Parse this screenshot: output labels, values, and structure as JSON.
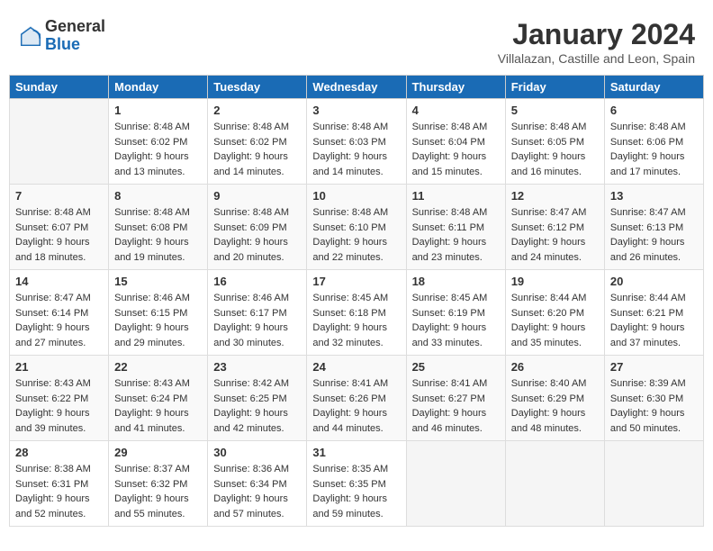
{
  "logo": {
    "general": "General",
    "blue": "Blue"
  },
  "header": {
    "month": "January 2024",
    "location": "Villalazan, Castille and Leon, Spain"
  },
  "weekdays": [
    "Sunday",
    "Monday",
    "Tuesday",
    "Wednesday",
    "Thursday",
    "Friday",
    "Saturday"
  ],
  "weeks": [
    [
      {
        "day": "",
        "sunrise": "",
        "sunset": "",
        "daylight": ""
      },
      {
        "day": "1",
        "sunrise": "Sunrise: 8:48 AM",
        "sunset": "Sunset: 6:02 PM",
        "daylight": "Daylight: 9 hours and 13 minutes."
      },
      {
        "day": "2",
        "sunrise": "Sunrise: 8:48 AM",
        "sunset": "Sunset: 6:02 PM",
        "daylight": "Daylight: 9 hours and 14 minutes."
      },
      {
        "day": "3",
        "sunrise": "Sunrise: 8:48 AM",
        "sunset": "Sunset: 6:03 PM",
        "daylight": "Daylight: 9 hours and 14 minutes."
      },
      {
        "day": "4",
        "sunrise": "Sunrise: 8:48 AM",
        "sunset": "Sunset: 6:04 PM",
        "daylight": "Daylight: 9 hours and 15 minutes."
      },
      {
        "day": "5",
        "sunrise": "Sunrise: 8:48 AM",
        "sunset": "Sunset: 6:05 PM",
        "daylight": "Daylight: 9 hours and 16 minutes."
      },
      {
        "day": "6",
        "sunrise": "Sunrise: 8:48 AM",
        "sunset": "Sunset: 6:06 PM",
        "daylight": "Daylight: 9 hours and 17 minutes."
      }
    ],
    [
      {
        "day": "7",
        "sunrise": "Sunrise: 8:48 AM",
        "sunset": "Sunset: 6:07 PM",
        "daylight": "Daylight: 9 hours and 18 minutes."
      },
      {
        "day": "8",
        "sunrise": "Sunrise: 8:48 AM",
        "sunset": "Sunset: 6:08 PM",
        "daylight": "Daylight: 9 hours and 19 minutes."
      },
      {
        "day": "9",
        "sunrise": "Sunrise: 8:48 AM",
        "sunset": "Sunset: 6:09 PM",
        "daylight": "Daylight: 9 hours and 20 minutes."
      },
      {
        "day": "10",
        "sunrise": "Sunrise: 8:48 AM",
        "sunset": "Sunset: 6:10 PM",
        "daylight": "Daylight: 9 hours and 22 minutes."
      },
      {
        "day": "11",
        "sunrise": "Sunrise: 8:48 AM",
        "sunset": "Sunset: 6:11 PM",
        "daylight": "Daylight: 9 hours and 23 minutes."
      },
      {
        "day": "12",
        "sunrise": "Sunrise: 8:47 AM",
        "sunset": "Sunset: 6:12 PM",
        "daylight": "Daylight: 9 hours and 24 minutes."
      },
      {
        "day": "13",
        "sunrise": "Sunrise: 8:47 AM",
        "sunset": "Sunset: 6:13 PM",
        "daylight": "Daylight: 9 hours and 26 minutes."
      }
    ],
    [
      {
        "day": "14",
        "sunrise": "Sunrise: 8:47 AM",
        "sunset": "Sunset: 6:14 PM",
        "daylight": "Daylight: 9 hours and 27 minutes."
      },
      {
        "day": "15",
        "sunrise": "Sunrise: 8:46 AM",
        "sunset": "Sunset: 6:15 PM",
        "daylight": "Daylight: 9 hours and 29 minutes."
      },
      {
        "day": "16",
        "sunrise": "Sunrise: 8:46 AM",
        "sunset": "Sunset: 6:17 PM",
        "daylight": "Daylight: 9 hours and 30 minutes."
      },
      {
        "day": "17",
        "sunrise": "Sunrise: 8:45 AM",
        "sunset": "Sunset: 6:18 PM",
        "daylight": "Daylight: 9 hours and 32 minutes."
      },
      {
        "day": "18",
        "sunrise": "Sunrise: 8:45 AM",
        "sunset": "Sunset: 6:19 PM",
        "daylight": "Daylight: 9 hours and 33 minutes."
      },
      {
        "day": "19",
        "sunrise": "Sunrise: 8:44 AM",
        "sunset": "Sunset: 6:20 PM",
        "daylight": "Daylight: 9 hours and 35 minutes."
      },
      {
        "day": "20",
        "sunrise": "Sunrise: 8:44 AM",
        "sunset": "Sunset: 6:21 PM",
        "daylight": "Daylight: 9 hours and 37 minutes."
      }
    ],
    [
      {
        "day": "21",
        "sunrise": "Sunrise: 8:43 AM",
        "sunset": "Sunset: 6:22 PM",
        "daylight": "Daylight: 9 hours and 39 minutes."
      },
      {
        "day": "22",
        "sunrise": "Sunrise: 8:43 AM",
        "sunset": "Sunset: 6:24 PM",
        "daylight": "Daylight: 9 hours and 41 minutes."
      },
      {
        "day": "23",
        "sunrise": "Sunrise: 8:42 AM",
        "sunset": "Sunset: 6:25 PM",
        "daylight": "Daylight: 9 hours and 42 minutes."
      },
      {
        "day": "24",
        "sunrise": "Sunrise: 8:41 AM",
        "sunset": "Sunset: 6:26 PM",
        "daylight": "Daylight: 9 hours and 44 minutes."
      },
      {
        "day": "25",
        "sunrise": "Sunrise: 8:41 AM",
        "sunset": "Sunset: 6:27 PM",
        "daylight": "Daylight: 9 hours and 46 minutes."
      },
      {
        "day": "26",
        "sunrise": "Sunrise: 8:40 AM",
        "sunset": "Sunset: 6:29 PM",
        "daylight": "Daylight: 9 hours and 48 minutes."
      },
      {
        "day": "27",
        "sunrise": "Sunrise: 8:39 AM",
        "sunset": "Sunset: 6:30 PM",
        "daylight": "Daylight: 9 hours and 50 minutes."
      }
    ],
    [
      {
        "day": "28",
        "sunrise": "Sunrise: 8:38 AM",
        "sunset": "Sunset: 6:31 PM",
        "daylight": "Daylight: 9 hours and 52 minutes."
      },
      {
        "day": "29",
        "sunrise": "Sunrise: 8:37 AM",
        "sunset": "Sunset: 6:32 PM",
        "daylight": "Daylight: 9 hours and 55 minutes."
      },
      {
        "day": "30",
        "sunrise": "Sunrise: 8:36 AM",
        "sunset": "Sunset: 6:34 PM",
        "daylight": "Daylight: 9 hours and 57 minutes."
      },
      {
        "day": "31",
        "sunrise": "Sunrise: 8:35 AM",
        "sunset": "Sunset: 6:35 PM",
        "daylight": "Daylight: 9 hours and 59 minutes."
      },
      {
        "day": "",
        "sunrise": "",
        "sunset": "",
        "daylight": ""
      },
      {
        "day": "",
        "sunrise": "",
        "sunset": "",
        "daylight": ""
      },
      {
        "day": "",
        "sunrise": "",
        "sunset": "",
        "daylight": ""
      }
    ]
  ]
}
